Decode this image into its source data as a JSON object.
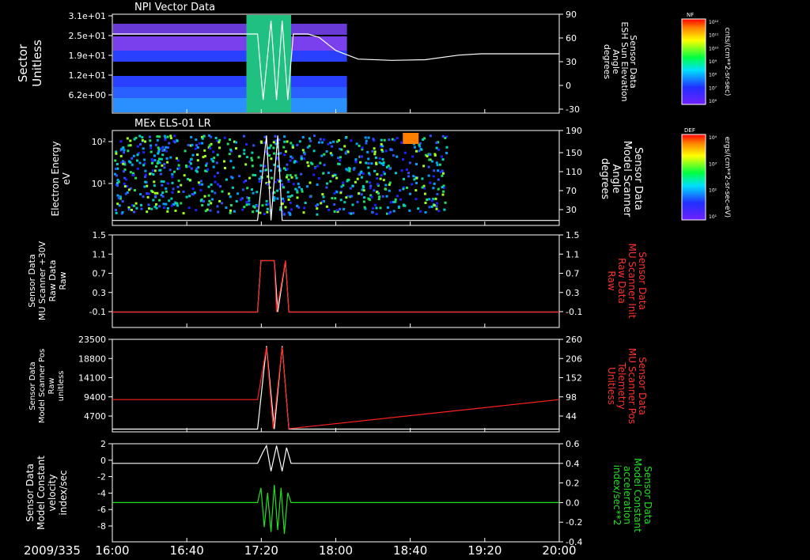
{
  "chart_data": {
    "type": "multi-panel-timeseries",
    "date_label": "2009/335",
    "time_ticks": [
      "16:00",
      "16:40",
      "17:20",
      "18:00",
      "18:40",
      "19:20",
      "20:00"
    ],
    "time_range_hours": [
      16,
      20
    ],
    "panels": [
      {
        "id": "p1",
        "title": "NPI Vector Data",
        "left_label": [
          "Sector",
          "Unitless"
        ],
        "left_ticks": [
          "3.1e+01",
          "2.5e+01",
          "1.9e+01",
          "1.2e+01",
          "6.2e+00"
        ],
        "right_label": [
          "Sensor Data",
          "ESH Sun Elevation",
          "Angle",
          "degrees"
        ],
        "right_ticks": [
          "90",
          "60",
          "30",
          "0",
          "-30"
        ],
        "right_label_color": "#ffffff",
        "right_ylim": [
          -60,
          90
        ],
        "colorbar": {
          "tag": "NF",
          "unit": "cnts/(cm**2-sr-sec)",
          "ticks": [
            "10¹²",
            "10¹¹",
            "10¹⁰",
            "10⁹",
            "10⁸",
            "10⁷",
            "10⁶"
          ]
        },
        "white_line": {
          "x": [
            16.0,
            17.25,
            17.3,
            17.35,
            17.42,
            17.47,
            17.52,
            17.57,
            17.62,
            17.7,
            17.75,
            17.85,
            18.0,
            18.2,
            18.5,
            18.8,
            19.1,
            19.3,
            19.5,
            20.0
          ],
          "y": [
            60,
            60,
            60,
            -40,
            80,
            -40,
            80,
            -40,
            60,
            60,
            60,
            55,
            35,
            22,
            20,
            21,
            28,
            30,
            30,
            30
          ]
        }
      },
      {
        "id": "p2",
        "title": "MEx ELS-01 LR",
        "left_label": [
          "Electron Energy",
          "eV"
        ],
        "left_ticks": [
          "10²",
          "10¹"
        ],
        "right_label": [
          "Sensor Data",
          "Model Scanner",
          "Angle",
          "degrees"
        ],
        "right_ticks": [
          "190",
          "150",
          "110",
          "70",
          "30"
        ],
        "right_label_color": "#ffffff",
        "right_ylim": [
          0,
          190
        ],
        "colorbar": {
          "tag": "DEF",
          "unit": "ergs/(cm**2-sr-sec-eV)",
          "ticks": [
            "10⁴",
            "10³",
            "10²",
            "10¹"
          ]
        },
        "white_line": {
          "x": [
            16.0,
            17.3,
            17.38,
            17.42,
            17.48,
            17.52,
            17.58,
            20.0
          ],
          "y": [
            10,
            10,
            180,
            10,
            180,
            10,
            10,
            10
          ]
        }
      },
      {
        "id": "p3",
        "left_label": [
          "Sensor Data",
          "MU Scanner +30V",
          "Raw Data",
          "Raw"
        ],
        "left_ticks": [
          "1.5",
          "1.1",
          "0.7",
          "0.3",
          "-0.1"
        ],
        "right_label": [
          "Sensor Data",
          "MU Scanner Init",
          "Raw Data",
          "Raw"
        ],
        "right_ticks": [
          "1.5",
          "1.1",
          "0.7",
          "0.3",
          "-0.1"
        ],
        "right_label_color": "#ff3030",
        "ylim": [
          -0.3,
          1.5
        ],
        "red_line": {
          "x": [
            16.0,
            17.3,
            17.33,
            17.45,
            17.47,
            17.55,
            17.58,
            20.0
          ],
          "y": [
            0,
            0,
            1,
            1,
            0,
            1,
            0,
            0
          ]
        },
        "white_line": {
          "x": [
            16.0,
            17.3,
            17.33,
            17.45,
            17.48,
            17.55,
            17.58,
            20.0
          ],
          "y": [
            0,
            0,
            1,
            1,
            0,
            1,
            0,
            0
          ]
        }
      },
      {
        "id": "p4",
        "left_label": [
          "Sensor Data",
          "Model Scanner Pos",
          "Raw",
          "unitless"
        ],
        "left_ticks": [
          "23500",
          "18800",
          "14100",
          "9400",
          "4700"
        ],
        "right_label": [
          "Sensor Data",
          "MU Scanner Pos",
          "Telemetry",
          "Unitless"
        ],
        "right_ticks": [
          "260",
          "206",
          "152",
          "98",
          "44"
        ],
        "right_label_color": "#ff3030",
        "ylim": [
          0,
          23500
        ],
        "red_line": {
          "x": [
            16.0,
            17.3,
            17.38,
            17.44,
            17.52,
            17.58,
            20.0
          ],
          "y": [
            8200,
            8200,
            21500,
            800,
            21500,
            800,
            8200
          ]
        },
        "white_line": {
          "x": [
            16.0,
            17.3,
            17.38,
            17.45,
            17.52,
            17.58,
            17.62,
            20.0
          ],
          "y": [
            700,
            700,
            21800,
            700,
            21800,
            700,
            700,
            700
          ]
        }
      },
      {
        "id": "p5",
        "left_label": [
          "Sensor Data",
          "Model Constant",
          "velocity",
          "index/sec"
        ],
        "left_ticks": [
          "2",
          "0",
          "-2",
          "-4",
          "-6",
          "-8"
        ],
        "right_label": [
          "Sensor Data",
          "Model Constant",
          "acceleration",
          "index/sec**2"
        ],
        "right_ticks": [
          "0.6",
          "0.4",
          "0.2",
          "0.0",
          "-0.2",
          "-0.4"
        ],
        "right_label_color": "#20e020",
        "ylim": [
          -8,
          2
        ],
        "white_line": {
          "x": [
            16.0,
            17.3,
            17.35,
            17.38,
            17.42,
            17.47,
            17.52,
            17.56,
            17.6,
            20.0
          ],
          "y": [
            0,
            0,
            1.2,
            1.8,
            -0.8,
            1.8,
            -0.8,
            1.6,
            0,
            0
          ]
        },
        "green_line": {
          "x": [
            16.0,
            17.3,
            17.33,
            17.36,
            17.39,
            17.42,
            17.45,
            17.48,
            17.51,
            17.54,
            17.57,
            17.6,
            20.0
          ],
          "y": [
            -4,
            -4,
            -2.5,
            -6.5,
            -3,
            -7,
            -2.2,
            -6.8,
            -2.5,
            -7.2,
            -3,
            -4,
            -4
          ]
        }
      }
    ]
  }
}
